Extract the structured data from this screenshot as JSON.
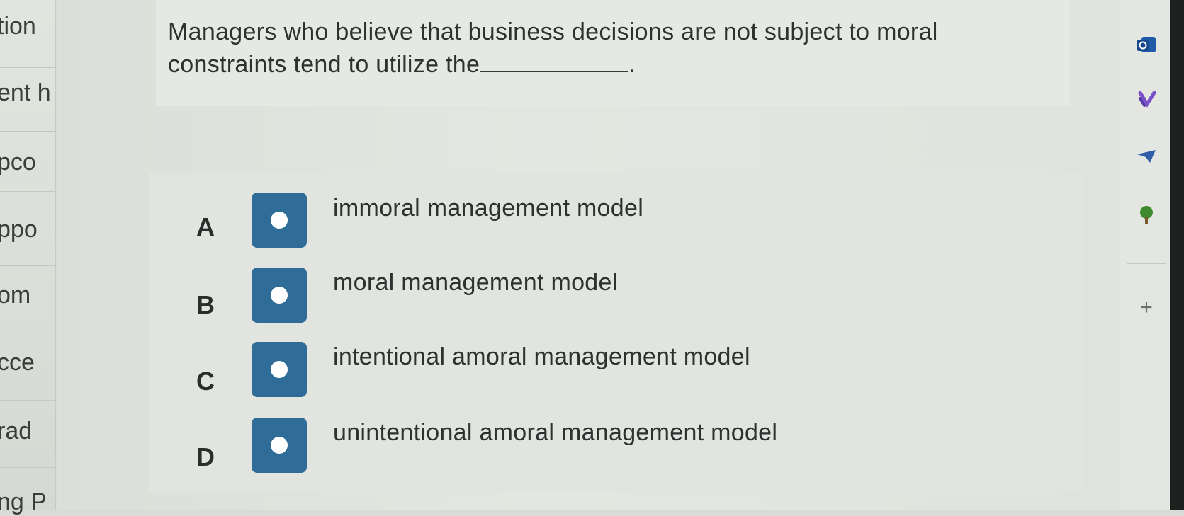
{
  "sidebar_left": {
    "items": [
      "tion",
      "ent h",
      "pco",
      "ppo",
      "om",
      "cce",
      "rad",
      "ng P"
    ]
  },
  "question": {
    "text_before": "Managers who believe that business decisions are not subject to moral constraints tend to utilize the",
    "text_after": "."
  },
  "options": [
    {
      "letter": "A",
      "text": "immoral management model"
    },
    {
      "letter": "B",
      "text": "moral management model"
    },
    {
      "letter": "C",
      "text": "intentional amoral management model"
    },
    {
      "letter": "D",
      "text": "unintentional amoral management model"
    }
  ],
  "sidebar_right": {
    "icons": [
      "outlook-icon",
      "todo-icon",
      "send-icon",
      "tree-icon"
    ],
    "add_label": "+"
  },
  "colors": {
    "radio_accent": "#2f6d98",
    "text": "#2f3131"
  }
}
